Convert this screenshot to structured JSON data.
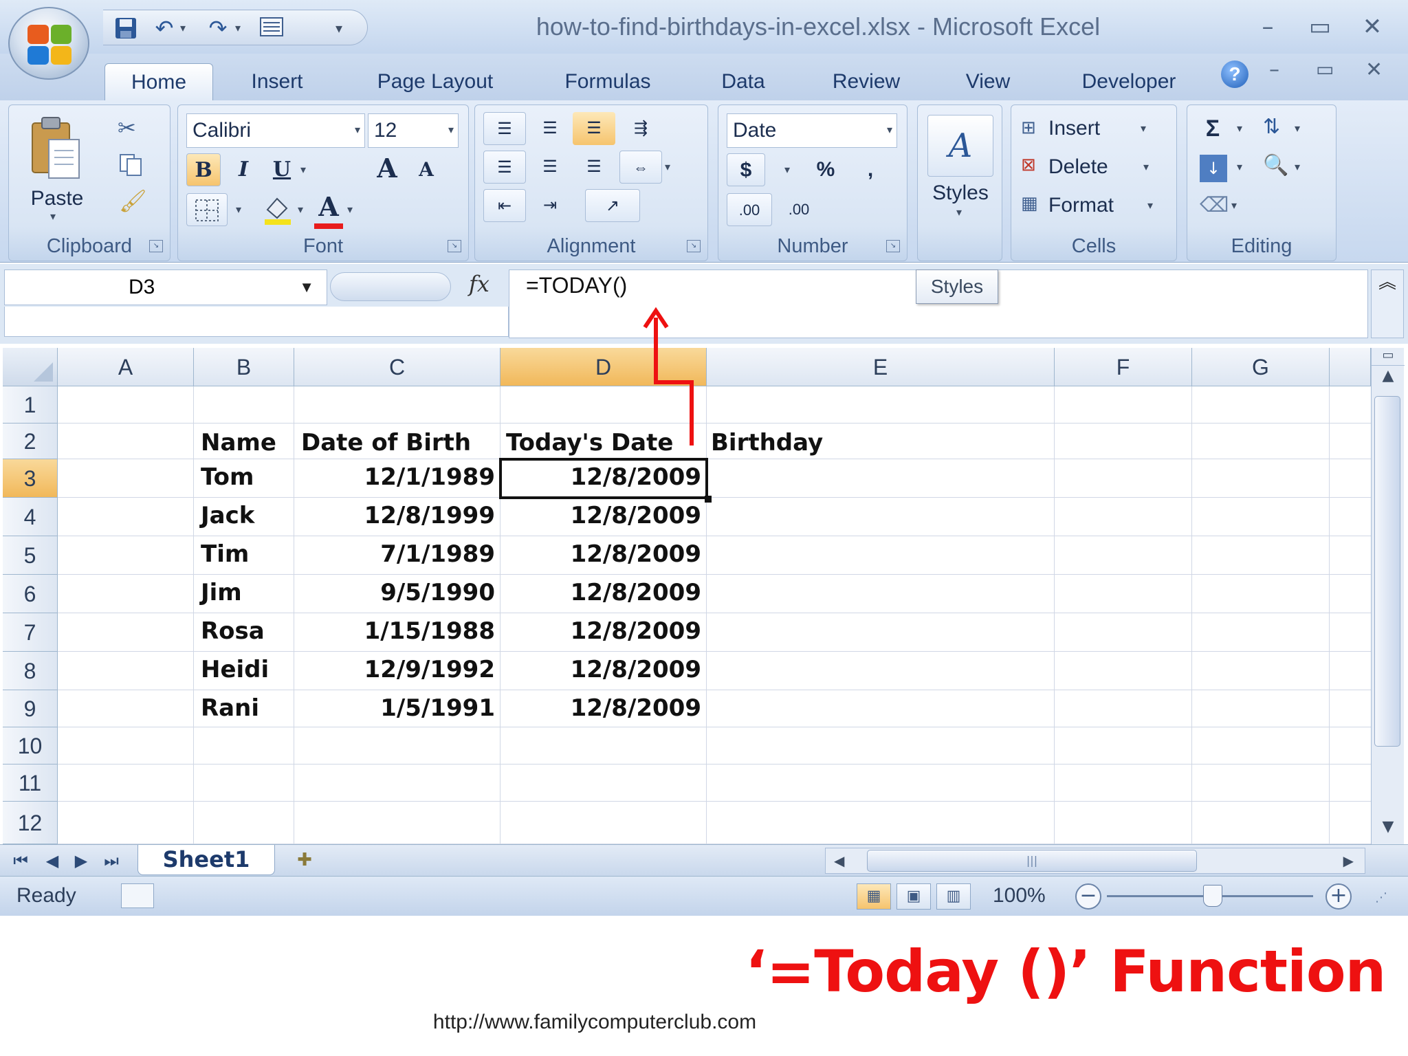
{
  "window": {
    "title": "how-to-find-birthdays-in-excel.xlsx - Microsoft Excel",
    "minimize": "–",
    "restore": "▭",
    "close": "✕"
  },
  "quick_access": {
    "save_icon": "save-icon",
    "undo_icon": "undo-icon",
    "redo_icon": "redo-icon",
    "form_icon": "form-icon"
  },
  "tabs": [
    "Home",
    "Insert",
    "Page Layout",
    "Formulas",
    "Data",
    "Review",
    "View",
    "Developer"
  ],
  "ribbon": {
    "clipboard": {
      "label": "Clipboard",
      "paste": "Paste"
    },
    "font": {
      "label": "Font",
      "family": "Calibri",
      "size": "12",
      "bold": "B",
      "italic": "I",
      "underline": "U",
      "grow": "A",
      "shrink": "A",
      "font_color": "A"
    },
    "alignment": {
      "label": "Alignment"
    },
    "number": {
      "label": "Number",
      "format": "Date",
      "currency": "$",
      "percent": "%",
      "comma": ",",
      "increase_decimal": ".00",
      "decrease_decimal": ".00"
    },
    "styles": {
      "label": "Styles"
    },
    "cells": {
      "label": "Cells",
      "insert": "Insert",
      "delete": "Delete",
      "format": "Format"
    },
    "editing": {
      "label": "Editing",
      "sum": "Σ"
    }
  },
  "formula_bar": {
    "name_box": "D3",
    "fx": "fx",
    "formula": "=TODAY()",
    "tooltip": "Styles"
  },
  "columns": [
    "A",
    "B",
    "C",
    "D",
    "E",
    "F",
    "G"
  ],
  "rows": [
    "1",
    "2",
    "3",
    "4",
    "5",
    "6",
    "7",
    "8",
    "9",
    "10",
    "11",
    "12"
  ],
  "selected_cell": "D3",
  "table": {
    "headers": [
      "Name",
      "Date of Birth",
      "Today's Date",
      "Birthday"
    ],
    "rows": [
      [
        "Tom",
        "12/1/1989",
        "12/8/2009"
      ],
      [
        "Jack",
        "12/8/1999",
        "12/8/2009"
      ],
      [
        "Tim",
        "7/1/1989",
        "12/8/2009"
      ],
      [
        "Jim",
        "9/5/1990",
        "12/8/2009"
      ],
      [
        "Rosa",
        "1/15/1988",
        "12/8/2009"
      ],
      [
        "Heidi",
        "12/9/1992",
        "12/8/2009"
      ],
      [
        "Rani",
        "1/5/1991",
        "12/8/2009"
      ]
    ]
  },
  "annotation": "‘=Today ()’  Function",
  "annotation_color": "#ee1111",
  "sheet": {
    "tab": "Sheet1"
  },
  "status": {
    "ready": "Ready",
    "zoom": "100%",
    "zoom_out": "−",
    "zoom_in": "+"
  },
  "footer_url": "http://www.familycomputerclub.com"
}
